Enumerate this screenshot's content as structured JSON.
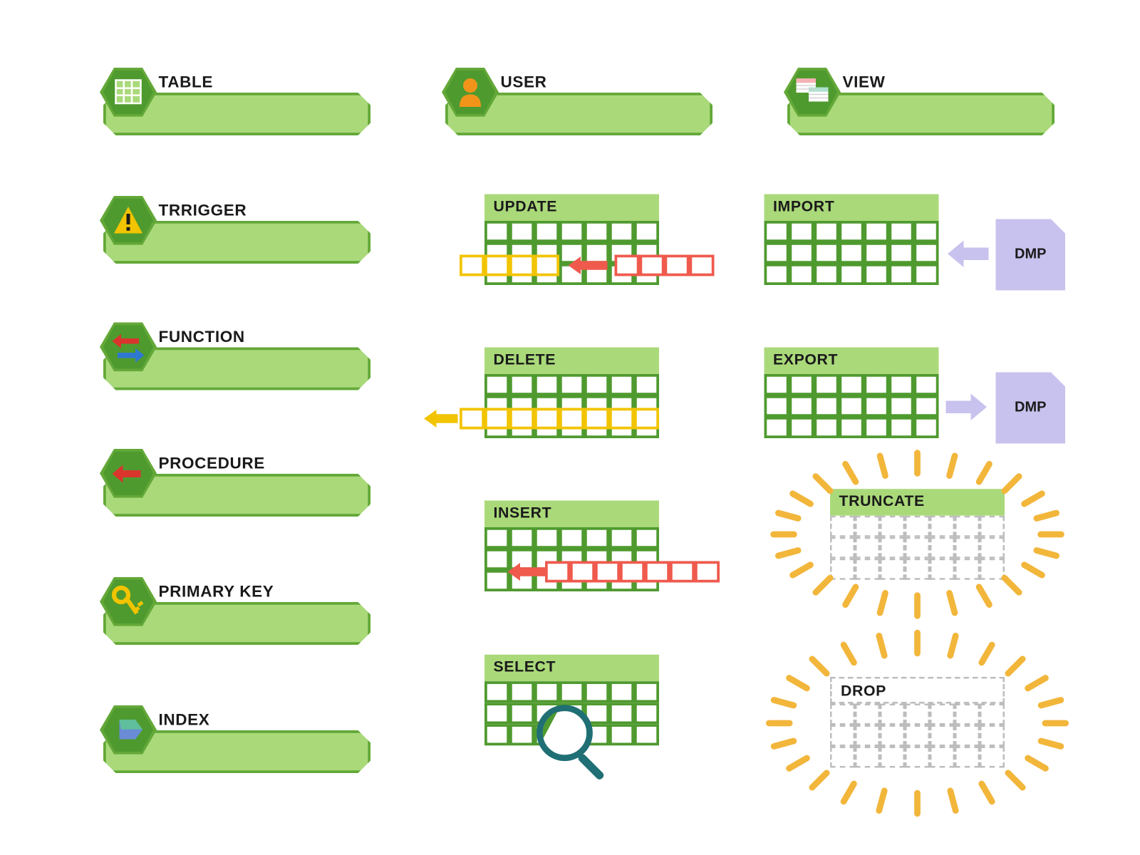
{
  "slots": {
    "table": {
      "label": "TABLE"
    },
    "user": {
      "label": "USER"
    },
    "view": {
      "label": "VIEW"
    },
    "trigger": {
      "label": "TRRIGGER"
    },
    "function": {
      "label": "FUNCTION"
    },
    "procedure": {
      "label": "PROCEDURE"
    },
    "primarykey": {
      "label": "PRIMARY KEY"
    },
    "index": {
      "label": "INDEX"
    }
  },
  "ops": {
    "update": {
      "label": "UPDATE"
    },
    "delete": {
      "label": "DELETE"
    },
    "insert": {
      "label": "INSERT"
    },
    "select": {
      "label": "SELECT"
    },
    "import": {
      "label": "IMPORT"
    },
    "export": {
      "label": "EXPORT"
    },
    "truncate": {
      "label": "TRUNCATE"
    },
    "drop": {
      "label": "DROP"
    }
  },
  "doc": {
    "dmp": "DMP"
  }
}
